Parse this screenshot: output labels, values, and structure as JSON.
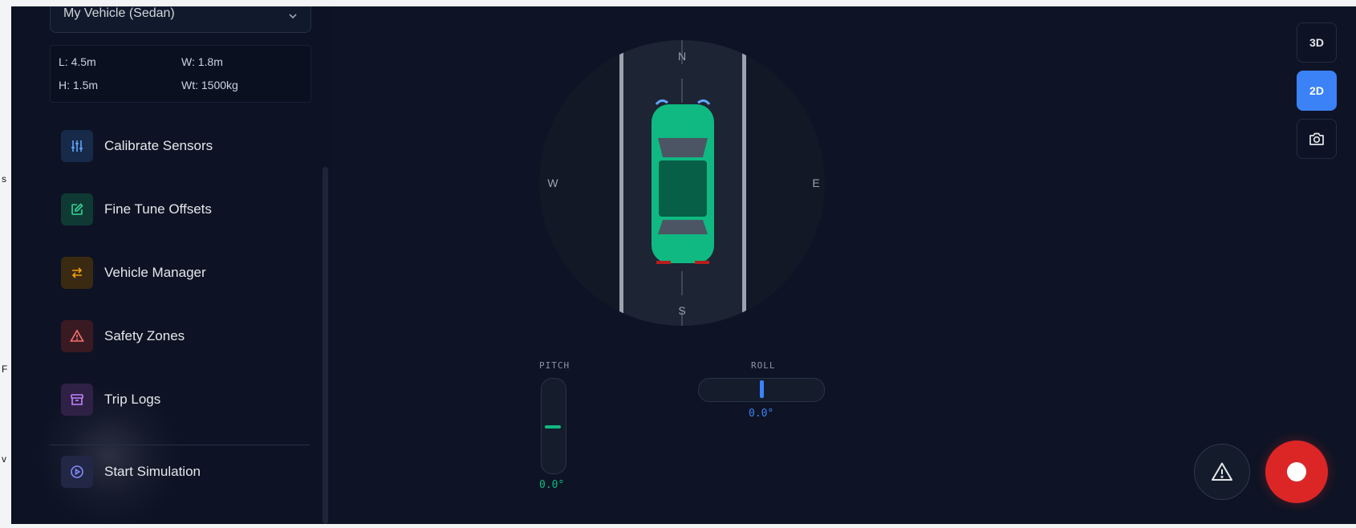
{
  "left_fragments": [
    "s",
    "F",
    "v"
  ],
  "sidebar": {
    "vehicle_select": {
      "value": "My Vehicle (Sedan)"
    },
    "specs": {
      "length": "L: 4.5m",
      "width": "W: 1.8m",
      "height": "H: 1.5m",
      "weight": "Wt: 1500kg"
    },
    "menu": [
      {
        "label": "Calibrate Sensors",
        "icon": "sliders-icon",
        "color": "#60a5fa",
        "bg": "#172a4a"
      },
      {
        "label": "Fine Tune Offsets",
        "icon": "edit-icon",
        "color": "#34d399",
        "bg": "#0f3a33"
      },
      {
        "label": "Vehicle Manager",
        "icon": "swap-icon",
        "color": "#f59e0b",
        "bg": "#3a2a12"
      },
      {
        "label": "Safety Zones",
        "icon": "alert-triangle-icon",
        "color": "#f87171",
        "bg": "#3a1a22"
      },
      {
        "label": "Trip Logs",
        "icon": "archive-icon",
        "color": "#c084fc",
        "bg": "#2f2145"
      },
      {
        "label": "Start Simulation",
        "icon": "play-circle-icon",
        "color": "#818cf8",
        "bg": "#232746"
      }
    ]
  },
  "compass": {
    "n": "N",
    "s": "S",
    "e": "E",
    "w": "W"
  },
  "gauges": {
    "pitch": {
      "label": "PITCH",
      "value": "0.0°",
      "color": "#10b981"
    },
    "roll": {
      "label": "ROLL",
      "value": "0.0°",
      "color": "#3b82f6"
    }
  },
  "view_controls": {
    "btn_3d": "3D",
    "btn_2d": "2D",
    "active": "2D"
  },
  "colors": {
    "accent": "#3b82f6",
    "record": "#dc2626",
    "car": "#10b981"
  }
}
